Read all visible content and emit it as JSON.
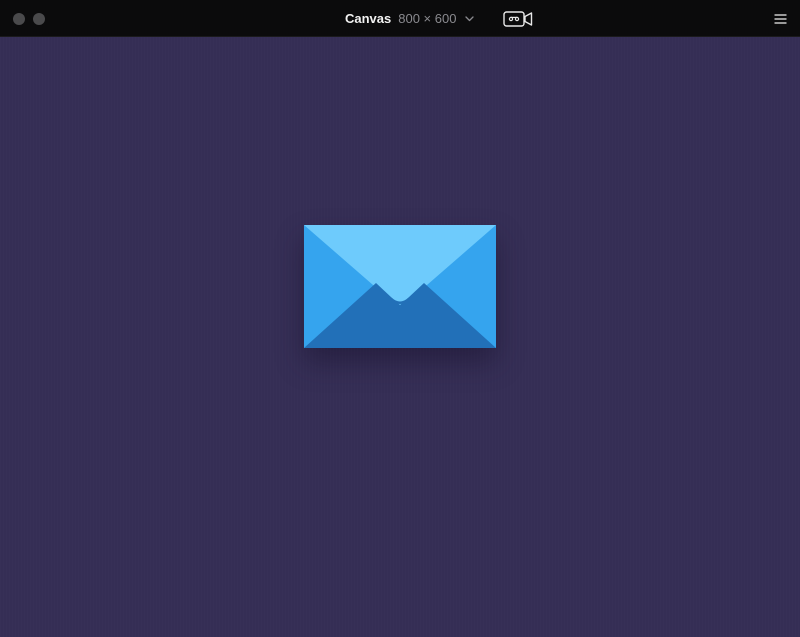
{
  "window": {
    "title": "Canvas",
    "size_label": "800 × 600"
  },
  "icons": {
    "dropdown": "chevron-down-icon",
    "record": "video-record-icon",
    "menu": "hamburger-menu-icon",
    "canvas_content": "mail-envelope-icon"
  },
  "colors": {
    "titlebar": "#0b0b0c",
    "canvas_background": "#352e55",
    "envelope_back": "#35a4ee",
    "envelope_flap": "#6ecbfc",
    "envelope_front": "#2270b8"
  }
}
